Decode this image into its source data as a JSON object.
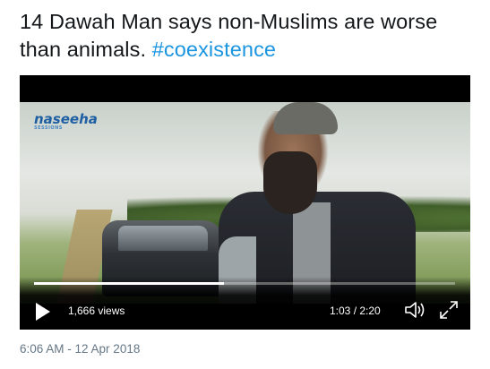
{
  "tweet": {
    "text": "14 Dawah Man says non-Muslims are worse than animals.",
    "hashtag": "#coexistence",
    "timestamp": "6:06 AM - 12 Apr 2018"
  },
  "video": {
    "logo_text": "naseeha",
    "logo_sub": "SESSIONS",
    "views": "1,666 views",
    "time": "1:03 / 2:20",
    "progress": 0.45,
    "colors": {
      "accent": "#1b95e0",
      "text": "#14171a",
      "muted": "#657786"
    }
  }
}
